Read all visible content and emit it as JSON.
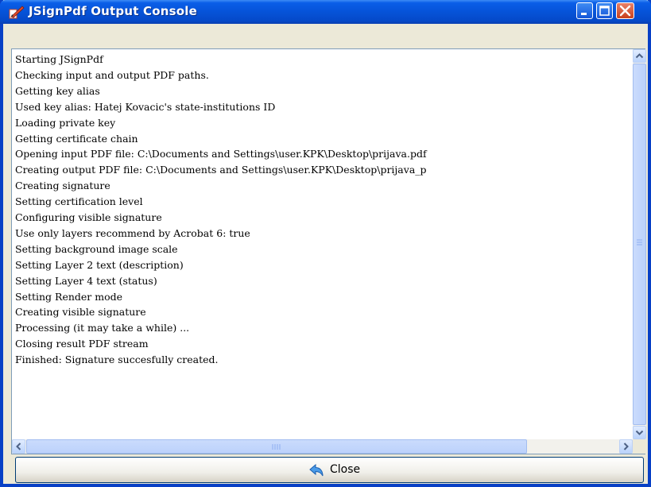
{
  "window": {
    "title": "JSignPdf Output Console"
  },
  "console": {
    "lines": [
      "Starting JSignPdf",
      "Checking input and output PDF paths.",
      "Getting key alias",
      "Used key alias: Hatej Kovacic's state-institutions ID",
      "Loading private key",
      "Getting certificate chain",
      "Opening input PDF file: C:\\Documents and Settings\\user.KPK\\Desktop\\prijava.pdf",
      "Creating output PDF file: C:\\Documents and Settings\\user.KPK\\Desktop\\prijava_p",
      "Creating signature",
      "Setting certification level",
      "Configuring visible signature",
      "Use only layers recommend by Acrobat 6: true",
      "Setting background image scale",
      "Setting Layer 2 text (description)",
      "Setting Layer 4 text (status)",
      "Setting Render mode",
      "Creating visible signature",
      "Processing (it may take a while) ...",
      "Closing result PDF stream",
      "Finished: Signature succesfully created."
    ]
  },
  "buttons": {
    "close_label": "Close"
  },
  "icons": {
    "app": "jsignpdf-pen-icon",
    "close_button": "back-arrow-icon",
    "title_minimize": "minimize-icon",
    "title_maximize": "maximize-icon",
    "title_close": "close-x-icon"
  },
  "colors": {
    "titlebar": "#0653d8",
    "window_border": "#0840c6",
    "close_title_button": "#d5502e",
    "dialog_background": "#ece9d8",
    "scrollbar_thumb": "#bcd2fb"
  }
}
